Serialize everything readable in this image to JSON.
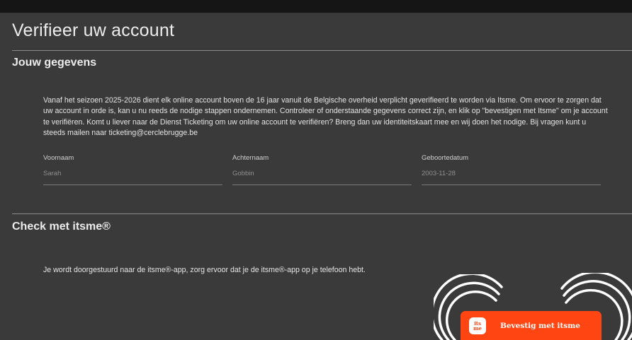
{
  "page": {
    "title": "Verifieer uw account"
  },
  "section_details": {
    "title": "Jouw gegevens",
    "intro": "Vanaf het seizoen 2025-2026 dient elk online account boven de 16 jaar vanuit de Belgische overheid verplicht geverifieerd te worden via Itsme. Om ervoor te zorgen dat uw account in orde is, kan u nu reeds de nodige stappen ondernemen. Controleer of onderstaande gegevens correct zijn, en klik op \"bevestigen met Itsme\" om je account te verifiëren. Komt u liever naar de Dienst Ticketing om uw online account te verifiëren? Breng dan uw identiteitskaart mee en wij doen het nodige. Bij vragen kunt u steeds mailen naar ticketing@cerclebrugge.be",
    "fields": [
      {
        "label": "Voornaam",
        "value": "Sarah"
      },
      {
        "label": "Achternaam",
        "value": "Gobbin"
      },
      {
        "label": "Geboortedatum",
        "value": "2003-11-28"
      }
    ]
  },
  "section_itsme": {
    "title": "Check met itsme®",
    "text": "Je wordt doorgestuurd naar de itsme®-app, zorg ervoor dat je de itsme®-app op je telefoon hebt.",
    "button_label": "Bevestig met itsme",
    "logo_line1": "its",
    "logo_line2": "me"
  },
  "colors": {
    "background": "#3a3a3a",
    "page_frame": "#151515",
    "accent": "#ff4612"
  }
}
